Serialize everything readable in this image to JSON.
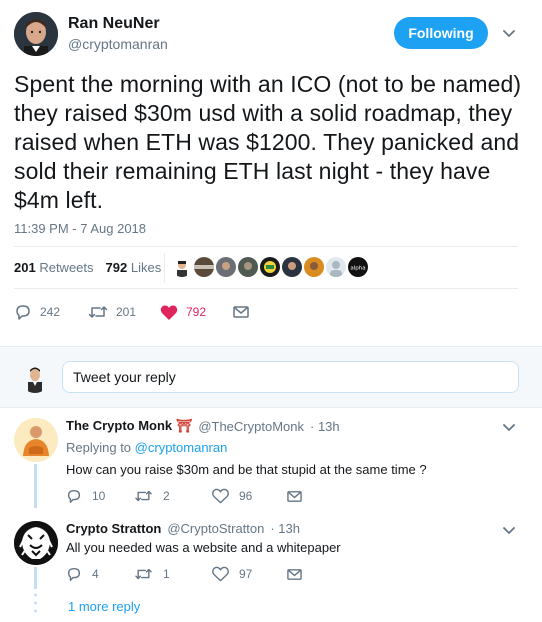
{
  "tweet": {
    "display_name": "Ran NeuNer",
    "handle": "@cryptomanran",
    "follow_label": "Following",
    "text": "Spent the morning with an ICO (not to be named) they raised $30m usd with a solid roadmap, they raised when ETH was $1200. They panicked and sold their remaining ETH last night - they have $4m left.",
    "timestamp": "11:39 PM - 7 Aug 2018",
    "retweets_count": "201",
    "retweets_label": "Retweets",
    "likes_count": "792",
    "likes_label": "Likes",
    "actions": {
      "replies": "242",
      "retweets": "201",
      "likes": "792"
    }
  },
  "reply_box": {
    "placeholder": "Tweet your reply"
  },
  "replies": [
    {
      "display_name": "The Crypto Monk",
      "name_emoji": "⛩",
      "handle": "@TheCryptoMonk",
      "time": "· 13h",
      "replying_to_label": "Replying to",
      "replying_to_handle": "@cryptomanran",
      "text": "How can you raise $30m and be that stupid at the same time ?",
      "actions": {
        "replies": "10",
        "retweets": "2",
        "likes": "96"
      }
    },
    {
      "display_name": "Crypto Stratton",
      "handle": "@CryptoStratton",
      "time": "· 13h",
      "text": "All you needed was a website and a whitepaper",
      "actions": {
        "replies": "4",
        "retweets": "1",
        "likes": "97"
      }
    }
  ],
  "more_replies": "1 more reply",
  "liker_badge_text": "alpha",
  "colors": {
    "accent": "#1da1f2",
    "like_red": "#e0245e",
    "text": "#14171a",
    "muted": "#657786",
    "border": "#e6ecf0"
  }
}
